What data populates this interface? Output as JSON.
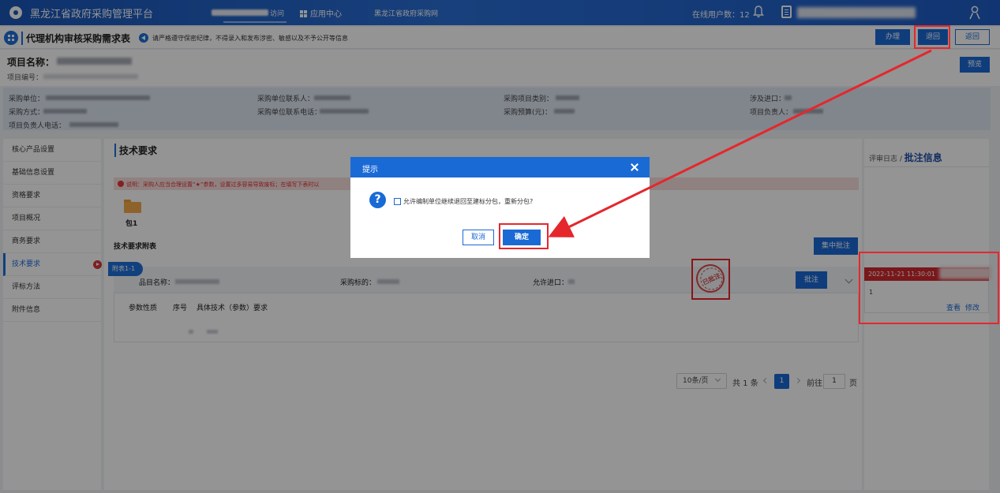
{
  "header": {
    "platform_title": "黑龙江省政府采购管理平台",
    "nav_fragment": "访问",
    "app_center": "应用中心",
    "portal_link": "黑龙江省政府采购网",
    "online_users": "在线用户数：12"
  },
  "title_row": {
    "page_title": "代理机构审核采购需求表",
    "notice": "请严格遵守保密纪律，不得录入和发布涉密、敏感以及不予公开等信息",
    "btn_handle": "办理",
    "btn_return": "退回",
    "btn_back": "返回"
  },
  "project": {
    "name_label": "项目名称：",
    "no_label": "项目编号：",
    "btn_preview": "预览"
  },
  "info": {
    "purchaser": "采购单位：",
    "purchase_method": "采购方式：",
    "project_phone": "项目负责人电话：",
    "contact": "采购单位联系人：",
    "contact_phone": "采购单位联系电话：",
    "category": "采购项目类别：",
    "budget": "采购预算(元)：",
    "import": "涉及进口：",
    "manager": "项目负责人："
  },
  "sidebar": {
    "items": [
      {
        "label": "核心产品设置"
      },
      {
        "label": "基础信息设置"
      },
      {
        "label": "资格要求"
      },
      {
        "label": "项目概况"
      },
      {
        "label": "商务要求"
      },
      {
        "label": "技术要求"
      },
      {
        "label": "评标方法"
      },
      {
        "label": "附件信息"
      }
    ]
  },
  "main": {
    "section_title": "技术要求",
    "warning": "说明：采购人应当合理设置“★”参数，设置过多容易导致废标；在填写下表时以",
    "package_label": "包1",
    "attach_title": "技术要求附表",
    "btn_batch": "集中批注",
    "attach_tab": "附表1-1",
    "item_name_label": "品目名称：",
    "target_label": "采购标的：",
    "import_label": "允许进口：",
    "btn_annotate": "批注",
    "stamp_text": "已批注",
    "col_param_type": "参数性质",
    "col_no": "序号",
    "col_spec": "具体技术（参数）要求"
  },
  "pagination": {
    "page_size": "10条/页",
    "total": "共 1 条",
    "current_page": "1",
    "goto_label": "前往",
    "goto_value": "1",
    "page_unit": "页"
  },
  "right_panel": {
    "log_label": "评审日志 / ",
    "annot_info": "批注信息",
    "log_time": "2022-11-21 11:30:01",
    "log_value": "1",
    "view": "查看",
    "edit": "修改"
  },
  "modal": {
    "title": "提示",
    "question_mark": "?",
    "message": "允许编制单位继续退回至建标分包，重新分包?",
    "cancel": "取消",
    "ok": "确定"
  },
  "colors": {
    "primary": "#1a6ad6",
    "highlight": "#e5272d",
    "log_head": "#d0282e"
  }
}
